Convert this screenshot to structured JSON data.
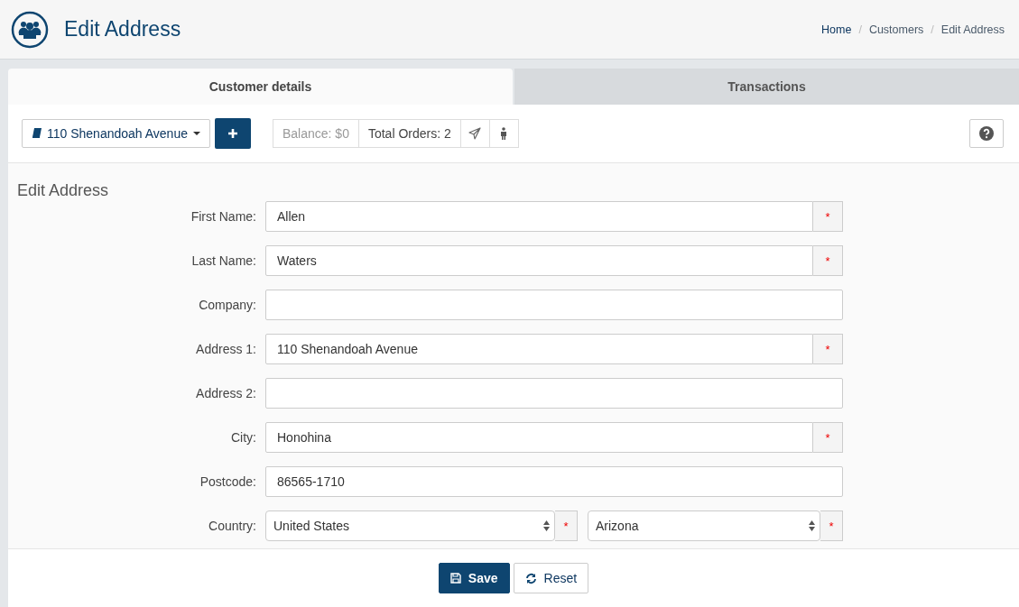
{
  "header": {
    "title": "Edit Address",
    "breadcrumb": [
      {
        "kind": "link",
        "label": "Home"
      },
      {
        "kind": "separator",
        "label": "/"
      },
      {
        "kind": "text",
        "label": "Customers"
      },
      {
        "kind": "separator",
        "label": "/"
      },
      {
        "kind": "text",
        "label": "Edit Address"
      }
    ]
  },
  "tabs": [
    {
      "label": "Customer details",
      "selected": true
    },
    {
      "label": "Transactions",
      "selected": false
    }
  ],
  "toolbar": {
    "address_dropdown": "110 Shenandoah Avenue",
    "balance": "Balance: $0",
    "total_orders": "Total Orders: 2"
  },
  "form": {
    "title": "Edit Address",
    "fields": [
      {
        "kind": "text",
        "label": "First Name:",
        "value": "Allen",
        "marker": "*"
      },
      {
        "kind": "text",
        "label": "Last Name:",
        "value": "Waters",
        "marker": "*"
      },
      {
        "kind": "text",
        "label": "Company:"
      },
      {
        "kind": "text",
        "label": "Address 1:",
        "value": "110 Shenandoah Avenue",
        "marker": "*"
      },
      {
        "kind": "text",
        "label": "Address 2:"
      },
      {
        "kind": "text",
        "label": "City:",
        "value": "Honohina",
        "marker": "*"
      },
      {
        "kind": "text",
        "label": "Postcode:",
        "value": "86565-1710"
      },
      {
        "kind": "selects",
        "label": "Country:",
        "selects": [
          {
            "value": "United States",
            "marker": "*"
          },
          {
            "value": "Arizona",
            "marker": "*"
          }
        ]
      }
    ]
  },
  "buttons": [
    {
      "kind": "save",
      "label": "Save"
    },
    {
      "kind": "reset",
      "label": "Reset"
    }
  ]
}
